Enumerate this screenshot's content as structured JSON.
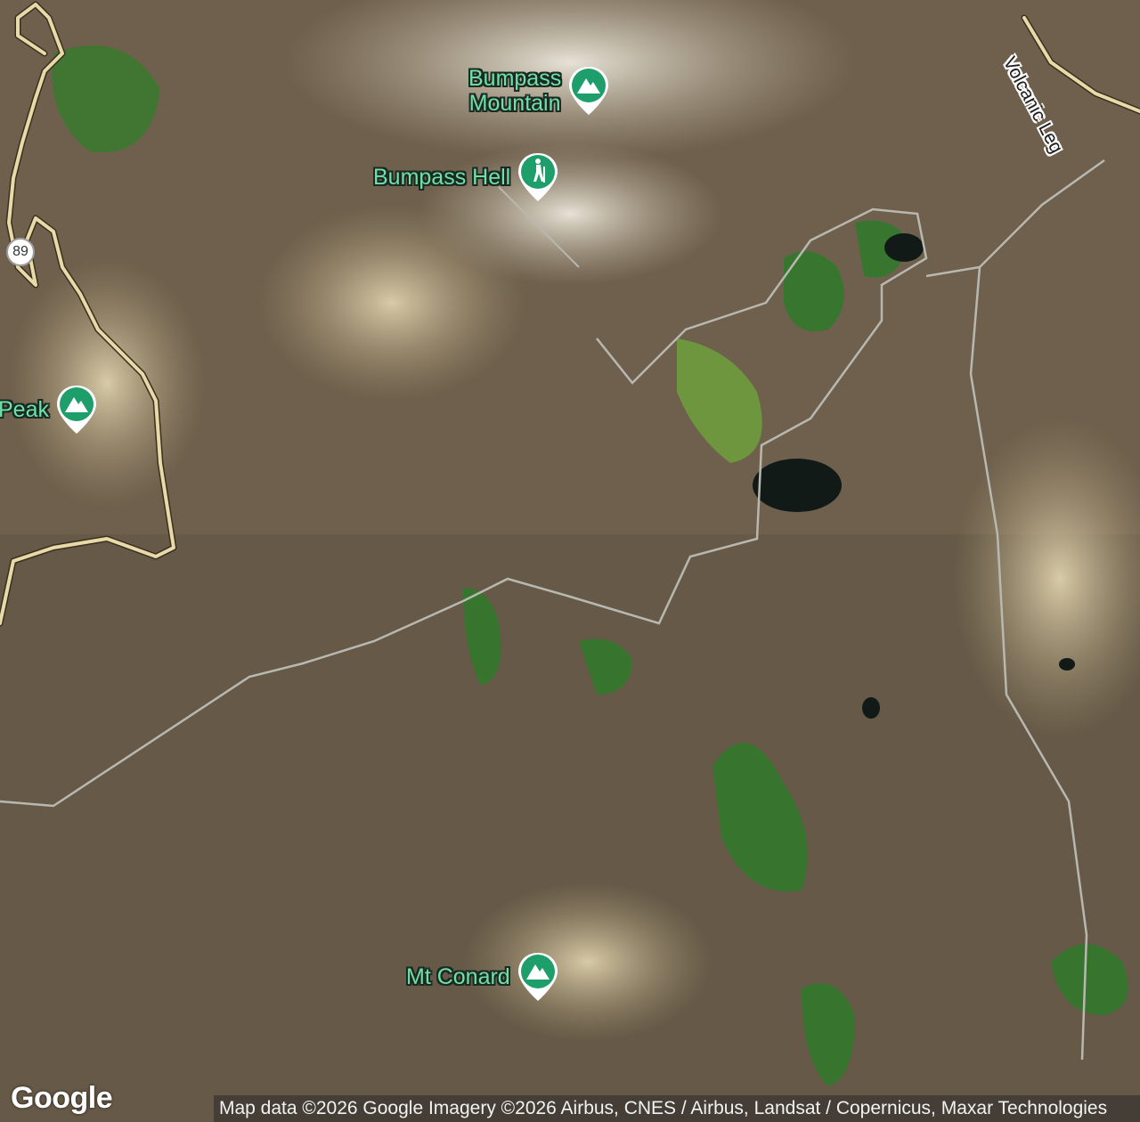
{
  "map": {
    "type": "satellite",
    "points_of_interest": [
      {
        "label": "Bumpass\nMountain",
        "icon": "mountain-icon"
      },
      {
        "label": "Bumpass Hell",
        "icon": "hiking-icon"
      },
      {
        "label": "Peak",
        "icon": "mountain-icon"
      },
      {
        "label": "Mt Conard",
        "icon": "mountain-icon"
      }
    ],
    "route_shield": "89",
    "road_label": "Volcanic Leg",
    "logo": "Google",
    "attribution": "Map data ©2026 Google Imagery ©2026 Airbus, CNES / Airbus, Landsat / Copernicus, Maxar Technologies",
    "colors": {
      "poi_pin": "#1e9e6a",
      "poi_text": "#6fe0a8",
      "road": "#e8d9a8"
    }
  }
}
